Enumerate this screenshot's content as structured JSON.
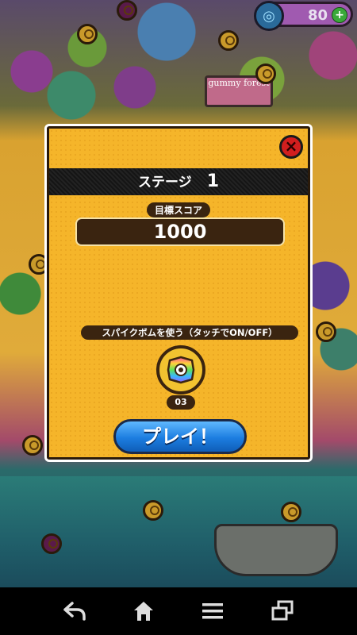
{
  "hud": {
    "currency_count": "80",
    "plus_label": "+",
    "icon": "swirl-icon"
  },
  "map": {
    "sign_text": "gummy forest"
  },
  "dialog": {
    "close_label": "×",
    "stage_label": "ステージ",
    "stage_number": "1",
    "target_score_label": "目標スコア",
    "target_score": "1000",
    "spike_bomb_label": "スパイクボムを使う（タッチでON/OFF）",
    "spike_bomb_count": "03",
    "play_label": "プレイ！"
  },
  "navbar": {
    "back_icon": "back-arrow-icon",
    "home_icon": "home-icon",
    "menu_icon": "menu-icon",
    "recent_icon": "recent-apps-icon"
  },
  "colors": {
    "dialog_bg": "#f5b52a",
    "dark_brown": "#3a2410",
    "close_red": "#d21e1e",
    "play_blue": "#1c7de0"
  }
}
